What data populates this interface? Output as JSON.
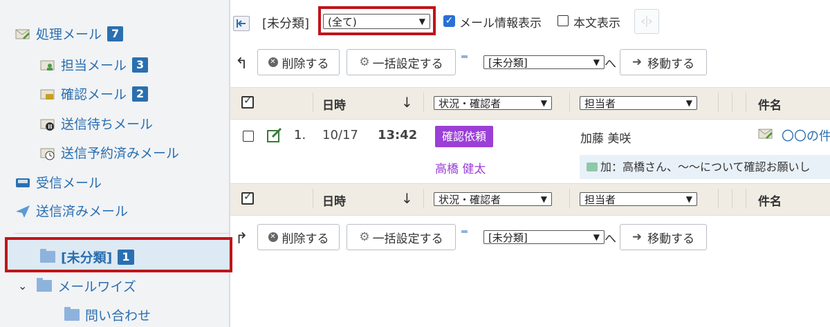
{
  "sidebar": {
    "items": [
      {
        "label": "処理メール",
        "badge": "7"
      },
      {
        "label": "担当メール",
        "badge": "3"
      },
      {
        "label": "確認メール",
        "badge": "2"
      },
      {
        "label": "送信待ちメール"
      },
      {
        "label": "送信予約済みメール"
      },
      {
        "label": "受信メール"
      },
      {
        "label": "送信済みメール"
      },
      {
        "label": "[未分類]",
        "badge": "1"
      },
      {
        "label": "メールワイズ"
      },
      {
        "label": "問い合わせ"
      }
    ]
  },
  "toolbar": {
    "folder_label": "[未分類]",
    "filter_value": "(全て)",
    "show_mail_info": "メール情報表示",
    "show_body": "本文表示",
    "delete_label": "削除する",
    "bulk_label": "一括設定する",
    "move_target": "[未分類]",
    "move_suffix": "へ",
    "move_label": "移動する"
  },
  "table": {
    "headers": {
      "datetime": "日時",
      "status": "状況・確認者",
      "assignee": "担当者",
      "subject": "件名"
    },
    "rows": [
      {
        "index": "1.",
        "date": "10/17",
        "time": "13:42",
        "status_badge": "確認依頼",
        "assignee": "加藤 美咲",
        "confirmer": "高橋 健太",
        "subject": "〇〇の件",
        "comment": "加：高橋さん、〜〜について確認お願いし"
      }
    ]
  },
  "colors": {
    "accent": "#2a6fb0",
    "badge_purple": "#9b3fd6",
    "highlight": "#c0141a"
  }
}
